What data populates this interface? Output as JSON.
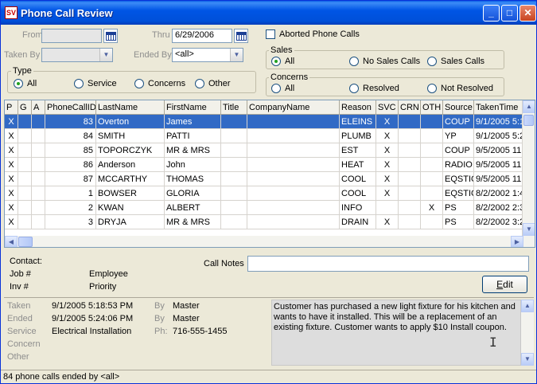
{
  "window": {
    "title": "Phone Call Review",
    "minimize": "_",
    "maximize": "□",
    "close": "✕",
    "app_icon": "SV"
  },
  "filters": {
    "from_label": "From",
    "from_value": "",
    "thru_label": "Thru",
    "thru_value": "6/29/2006",
    "taken_by_label": "Taken By",
    "taken_by_value": "",
    "ended_by_label": "Ended By",
    "ended_by_value": "<all>",
    "aborted_label": "Aborted Phone Calls",
    "type": {
      "title": "Type",
      "options": [
        "All",
        "Service",
        "Concerns",
        "Other"
      ],
      "selected": "All"
    },
    "sales": {
      "title": "Sales",
      "options": [
        "All",
        "No Sales Calls",
        "Sales Calls"
      ],
      "selected": "All"
    },
    "concerns": {
      "title": "Concerns",
      "options": [
        "All",
        "Resolved",
        "Not Resolved"
      ],
      "selected": "All"
    }
  },
  "grid": {
    "columns": [
      "P",
      "G",
      "A",
      "PhoneCallID",
      "LastName",
      "FirstName",
      "Title",
      "CompanyName",
      "Reason",
      "SVC",
      "CRN",
      "OTH",
      "Source",
      "TakenTime"
    ],
    "rows": [
      [
        "X",
        "",
        "",
        "83",
        "Overton",
        "James",
        "",
        "",
        "ELEINS",
        "X",
        "",
        "",
        "COUP",
        "9/1/2005 5:1"
      ],
      [
        "X",
        "",
        "",
        "84",
        "SMITH",
        "PATTI",
        "",
        "",
        "PLUMB",
        "X",
        "",
        "",
        "YP",
        "9/1/2005 5:2"
      ],
      [
        "X",
        "",
        "",
        "85",
        "TOPORCZYK",
        "MR & MRS",
        "",
        "",
        "EST",
        "X",
        "",
        "",
        "COUP",
        "9/5/2005 11"
      ],
      [
        "X",
        "",
        "",
        "86",
        "Anderson",
        "John",
        "",
        "",
        "HEAT",
        "X",
        "",
        "",
        "RADIO",
        "9/5/2005 11"
      ],
      [
        "X",
        "",
        "",
        "87",
        "MCCARTHY",
        "THOMAS",
        "",
        "",
        "COOL",
        "X",
        "",
        "",
        "EQSTIC",
        "9/5/2005 11"
      ],
      [
        "X",
        "",
        "",
        "1",
        "BOWSER",
        "GLORIA",
        "",
        "",
        "COOL",
        "X",
        "",
        "",
        "EQSTIC",
        "8/2/2002 1:4"
      ],
      [
        "X",
        "",
        "",
        "2",
        "KWAN",
        "ALBERT",
        "",
        "",
        "INFO",
        "",
        "",
        "X",
        "PS",
        "8/2/2002 2:3"
      ],
      [
        "X",
        "",
        "",
        "3",
        "DRYJA",
        "MR & MRS",
        "",
        "",
        "DRAIN",
        "X",
        "",
        "",
        "PS",
        "8/2/2002 3:2"
      ]
    ],
    "selected_row": 0
  },
  "details": {
    "contact_label": "Contact:",
    "job_label": "Job #",
    "employee_label": "Employee",
    "inv_label": "Inv #",
    "priority_label": "Priority",
    "call_notes_label": "Call Notes",
    "edit_label": "Edit",
    "taken_label": "Taken",
    "taken_value": "9/1/2005 5:18:53 PM",
    "taken_by_label": "By",
    "taken_by_value": "Master",
    "ended_label": "Ended",
    "ended_value": "9/1/2005 5:24:06 PM",
    "ended_by_label": "By",
    "ended_by_value": "Master",
    "service_label": "Service",
    "service_value": "Electrical Installation",
    "phone_label": "Ph:",
    "phone_value": "716-555-1455",
    "concern_label": "Concern",
    "other_label": "Other",
    "memo": "Customer has purchased a new light fixture for his kitchen and wants to have it installed. This will be a replacement of an existing fixture. Customer wants to apply $10 Install coupon."
  },
  "status": "84 phone calls ended by <all>"
}
